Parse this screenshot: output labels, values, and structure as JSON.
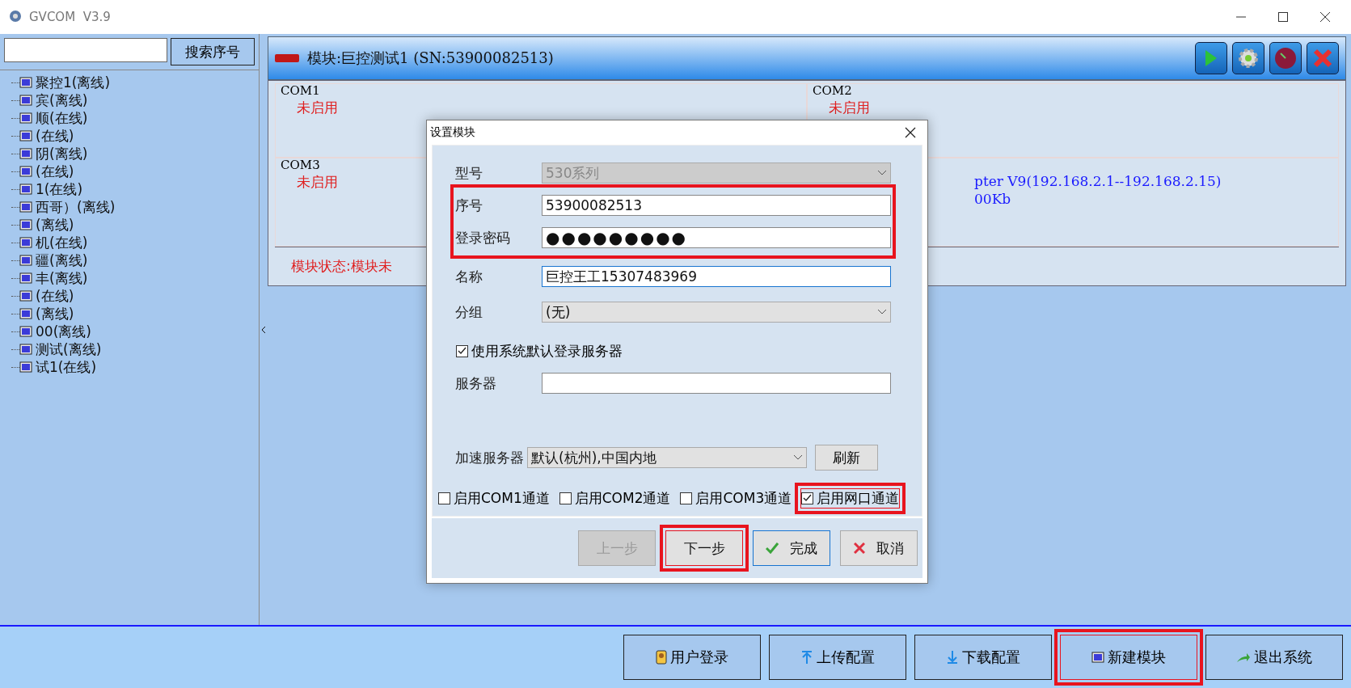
{
  "window": {
    "title": "GVCOM  V3.9"
  },
  "sidebar": {
    "search_button": "搜索序号",
    "items": [
      {
        "label": "聚控1(离线)"
      },
      {
        "label": "宾(离线)"
      },
      {
        "label": "顺(在线)"
      },
      {
        "label": "(在线)"
      },
      {
        "label": "阴(离线)"
      },
      {
        "label": "(在线)"
      },
      {
        "label": "1(在线)"
      },
      {
        "label": "西哥）(离线)"
      },
      {
        "label": "(离线)"
      },
      {
        "label": "机(在线)"
      },
      {
        "label": "疆(离线)"
      },
      {
        "label": "丰(离线)"
      },
      {
        "label": "(在线)"
      },
      {
        "label": "(离线)"
      },
      {
        "label": "00(离线)"
      },
      {
        "label": "测试(离线)"
      },
      {
        "label": "试1(在线)"
      }
    ]
  },
  "module": {
    "title": "模块:巨控测试1 (SN:53900082513)",
    "ports": [
      {
        "name": "COM1",
        "lines": [
          {
            "text": "未启用",
            "kind": "off"
          }
        ]
      },
      {
        "name": "COM2",
        "lines": [
          {
            "text": "未启用",
            "kind": "off"
          }
        ]
      },
      {
        "name": "COM3",
        "lines": [
          {
            "text": "未启用",
            "kind": "off"
          }
        ]
      },
      {
        "lines": [
          {
            "text": "pter V9(192.168.2.1--192.168.2.15)",
            "kind": "info"
          },
          {
            "text": "00Kb",
            "kind": "info"
          }
        ]
      }
    ],
    "status": "模块状态:模块未"
  },
  "dialog": {
    "title": "设置模块",
    "model": {
      "label": "型号",
      "value": "530系列",
      "disabled": true
    },
    "serial": {
      "label": "序号",
      "value": "53900082513"
    },
    "password": {
      "label": "登录密码",
      "value": "●●●●●●●●●"
    },
    "credentials_highlighted": true,
    "name": {
      "label": "名称",
      "value": "巨控王工15307483969"
    },
    "group": {
      "label": "分组",
      "value": "(无)"
    },
    "default_server": {
      "label": "使用系统默认登录服务器",
      "checked": true
    },
    "server": {
      "label": "服务器"
    },
    "accel": {
      "label": "加速服务器",
      "value": "默认(杭州),中国内地",
      "button": "刷新"
    },
    "channels": [
      {
        "label": "启用COM1通道",
        "checked": false,
        "highlighted": false
      },
      {
        "label": "启用COM2通道",
        "checked": false,
        "highlighted": false
      },
      {
        "label": "启用COM3通道",
        "checked": false,
        "highlighted": false
      },
      {
        "label": "启用网口通道",
        "checked": true,
        "highlighted": true
      }
    ],
    "buttons": [
      {
        "label": "上一步",
        "kind": "plain",
        "disabled": true,
        "highlighted": false
      },
      {
        "label": "下一步",
        "kind": "plain",
        "disabled": false,
        "highlighted": true
      },
      {
        "label": "完成",
        "kind": "ok",
        "disabled": false,
        "highlighted": false
      },
      {
        "label": "取消",
        "kind": "cancel",
        "disabled": false,
        "highlighted": false
      }
    ]
  },
  "bottom_buttons": [
    {
      "label": "用户登录",
      "kind": "user",
      "highlighted": false
    },
    {
      "label": "上传配置",
      "kind": "upload",
      "highlighted": false
    },
    {
      "label": "下载配置",
      "kind": "download",
      "highlighted": false
    },
    {
      "label": "新建模块",
      "kind": "module",
      "highlighted": true
    },
    {
      "label": "退出系统",
      "kind": "exit",
      "highlighted": false
    }
  ]
}
